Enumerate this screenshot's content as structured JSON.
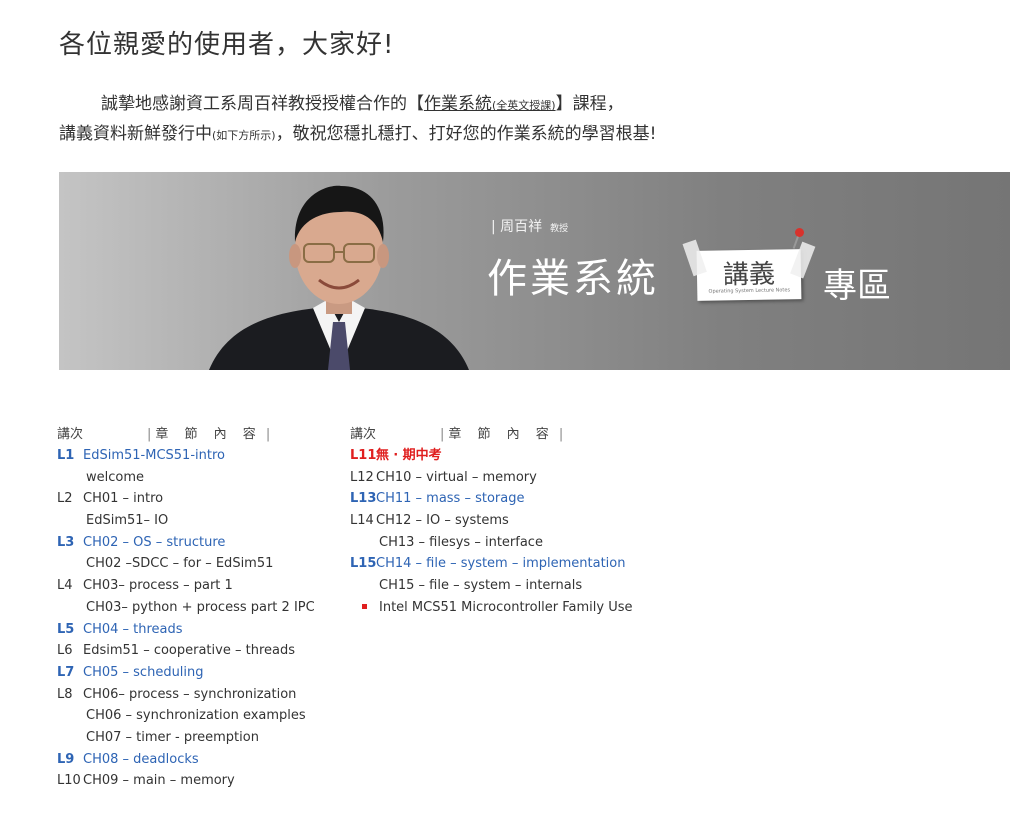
{
  "greeting": "各位親愛的使用者，大家好!",
  "intro": {
    "line1_prefix": "誠摯地感謝資工系周百祥教授授權合作的【",
    "course_link": "作業系統",
    "course_link_note": "(全英文授課)",
    "line1_suffix": "】課程，",
    "line2_prefix": "講義資料新鮮發行中",
    "line2_note": "(如下方所示)",
    "line2_suffix": "，敬祝您穩扎穩打、打好您的作業系統的學習根基!"
  },
  "banner": {
    "professor": "| 周百祥",
    "professor_title": "教授",
    "title": "作業系統",
    "note_word": "講義",
    "note_tiny": "Operating System Lecture Notes",
    "zone": "專區"
  },
  "header": {
    "lecture": "講次",
    "section_label": "章 節 內 容"
  },
  "left_rows": [
    {
      "num": "L1",
      "text": "EdSim51-MCS51-intro",
      "style": "blue"
    },
    {
      "num": "",
      "text": "welcome",
      "style": "indent"
    },
    {
      "num": "L2",
      "text": "CH01 – intro",
      "style": ""
    },
    {
      "num": "",
      "text": "EdSim51– IO",
      "style": "indent"
    },
    {
      "num": "L3",
      "text": "CH02 – OS – structure",
      "style": "blue"
    },
    {
      "num": "",
      "text": "CH02 –SDCC – for – EdSim51",
      "style": "indent"
    },
    {
      "num": "L4",
      "text": "CH03– process – part 1",
      "style": ""
    },
    {
      "num": "",
      "text": "CH03– python  +  process part 2 IPC",
      "style": "indent"
    },
    {
      "num": "L5",
      "text": "CH04 – threads",
      "style": "blue"
    },
    {
      "num": "L6",
      "text": "Edsim51 – cooperative – threads",
      "style": ""
    },
    {
      "num": "L7",
      "text": "CH05 – scheduling",
      "style": "blue"
    },
    {
      "num": "L8",
      "text": "CH06– process – synchronization",
      "style": ""
    },
    {
      "num": "",
      "text": "CH06 – synchronization examples",
      "style": "indent"
    },
    {
      "num": "",
      "text": "CH07 – timer - preemption",
      "style": "indent"
    },
    {
      "num": "L9",
      "text": "CH08 – deadlocks",
      "style": "blue"
    },
    {
      "num": "L10",
      "text": "CH09 – main – memory",
      "style": ""
    }
  ],
  "right_rows": [
    {
      "num": "L11",
      "text": "無 ‧ 期中考",
      "style": "red"
    },
    {
      "num": "L12",
      "text": "CH10 – virtual – memory",
      "style": ""
    },
    {
      "num": "L13",
      "text": "CH11 – mass – storage",
      "style": "blue"
    },
    {
      "num": "L14",
      "text": "CH12 – IO – systems",
      "style": ""
    },
    {
      "num": "",
      "text": "CH13 – filesys – interface",
      "style": "indent"
    },
    {
      "num": "L15",
      "text": "CH14 – file – system – implementation",
      "style": "blue"
    },
    {
      "num": "",
      "text": "CH15 – file – system – internals",
      "style": "indent"
    },
    {
      "num": "",
      "text": "Intel MCS51 Microcontroller Family Use",
      "style": "bullet"
    }
  ]
}
